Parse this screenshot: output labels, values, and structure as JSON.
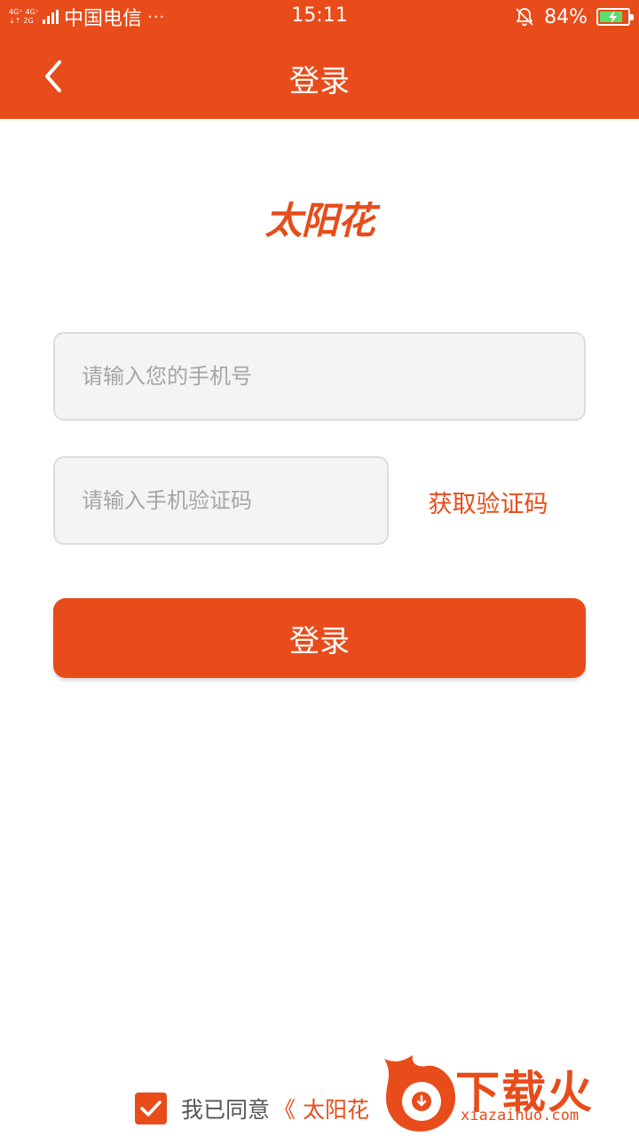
{
  "status_bar": {
    "net_top": [
      "4G⁺",
      "4G⁺"
    ],
    "net_bottom": [
      "⇣⇡",
      "2G"
    ],
    "carrier": "中国电信",
    "dots": "···",
    "time": "15:11",
    "battery": "84%",
    "battery_level": 0.84,
    "icons": [
      "signal-icon",
      "mute-bell-icon",
      "battery-charging-icon"
    ]
  },
  "nav": {
    "title": "登录",
    "back_icon": "chevron-left-icon"
  },
  "logo": "太阳花",
  "form": {
    "phone_placeholder": "请输入您的手机号",
    "code_placeholder": "请输入手机验证码",
    "get_code_label": "获取验证码",
    "login_label": "登录"
  },
  "agreement": {
    "checked": true,
    "text": "我已同意",
    "link": "《 太阳花"
  },
  "watermark": {
    "brand": "下载火",
    "url": "xiazaihuo.com"
  },
  "colors": {
    "accent": "#e84c1a",
    "input_bg": "#f4f4f4",
    "placeholder": "#a6a6a6"
  }
}
